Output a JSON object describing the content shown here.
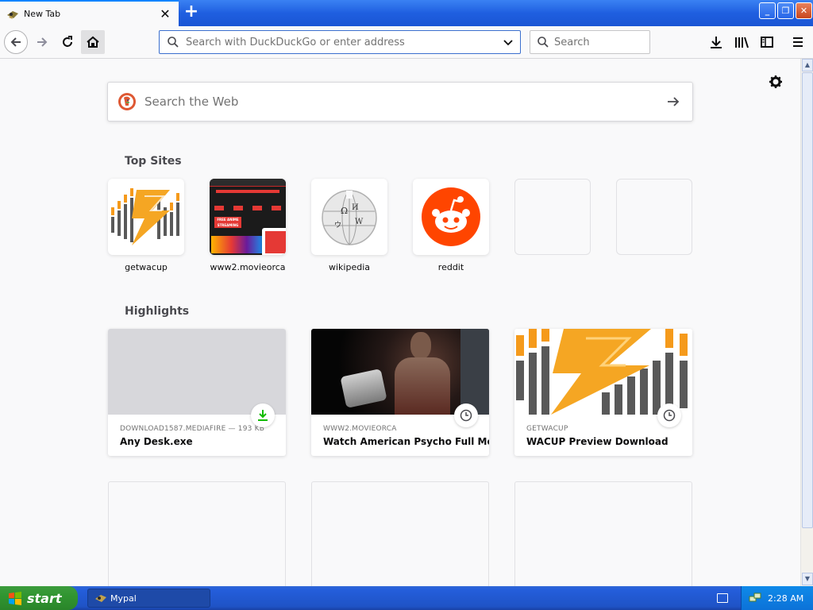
{
  "tab": {
    "title": "New Tab"
  },
  "toolbar": {
    "url_placeholder": "Search with DuckDuckGo or enter address",
    "search_placeholder": "Search"
  },
  "newtab": {
    "websearch_placeholder": "Search the Web",
    "top_sites_title": "Top Sites",
    "top_sites": [
      {
        "label": "getwacup"
      },
      {
        "label": "www2.movieorca"
      },
      {
        "label": "wikipedia"
      },
      {
        "label": "reddit"
      },
      {
        "label": ""
      },
      {
        "label": ""
      }
    ],
    "highlights_title": "Highlights",
    "highlights": [
      {
        "context": "DOWNLOAD1587.MEDIAFIRE — 193 KB",
        "title": "Any Desk.exe",
        "badge": "download-icon"
      },
      {
        "context": "WWW2.MOVIEORCA",
        "title": "Watch American Psycho Full Mo...",
        "badge": "clock-icon"
      },
      {
        "context": "GETWACUP",
        "title": "WACUP Preview Download",
        "badge": "clock-icon"
      }
    ]
  },
  "movieorca_thumb": {
    "line1": "FREE ANIME",
    "line2": "STREAMING"
  },
  "taskbar": {
    "start_label": "start",
    "task_label": "Mypal",
    "clock": "2:28 AM"
  },
  "colors": {
    "accent": "#0a84ff",
    "reddit": "#ff4500",
    "wacup_orange": "#f59a1b",
    "download_green": "#12bc00"
  }
}
